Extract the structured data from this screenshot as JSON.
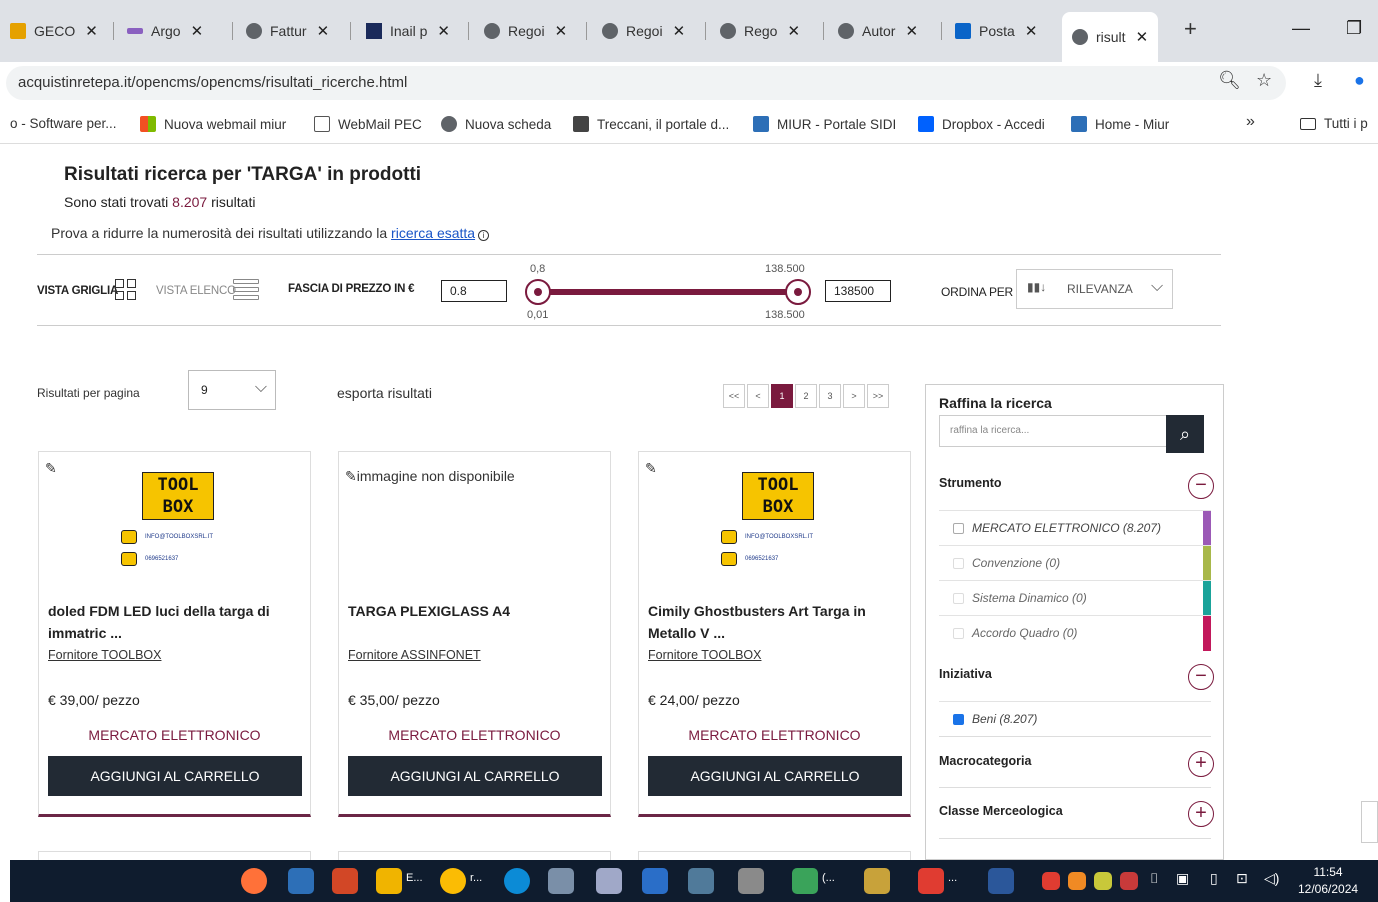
{
  "browser": {
    "tabs": [
      {
        "label": "GECO"
      },
      {
        "label": "Argo"
      },
      {
        "label": "Fattur"
      },
      {
        "label": "Inail p"
      },
      {
        "label": "Regoi"
      },
      {
        "label": "Regoi"
      },
      {
        "label": "Rego"
      },
      {
        "label": "Autor"
      },
      {
        "label": "Posta"
      },
      {
        "label": "risult"
      }
    ],
    "url": "acquistinretepa.it/opencms/opencms/risultati_ricerche.html",
    "bookmarks": [
      "o - Software per...",
      "Nuova webmail miur",
      "WebMail PEC",
      "Nuova scheda",
      "Treccani, il portale d...",
      "MIUR - Portale SIDI",
      "Dropbox - Accedi",
      "Home - Miur"
    ],
    "all_bookmarks": "Tutti i p"
  },
  "results": {
    "title": "Risultati ricerca per 'TARGA' in prodotti",
    "found_prefix": "Sono stati trovati ",
    "found_count": "8.207",
    "found_suffix": " risultati",
    "hint_prefix": "Prova a ridurre la numerosità dei risultati utilizzando la ",
    "hint_link": "ricerca esatta"
  },
  "toolbar": {
    "grid_view": "VISTA GRIGLIA",
    "list_view": "VISTA ELENCO",
    "price_label": "FASCIA DI PREZZO IN €",
    "price_min": "0.8",
    "price_max": "138500",
    "slider_top_min": "0,8",
    "slider_top_max": "138.500",
    "slider_bottom_min": "0,01",
    "slider_bottom_max": "138.500",
    "sort_label": "ORDINA PER",
    "sort_value": "RILEVANZA"
  },
  "listing": {
    "per_page_label": "Risultati per pagina",
    "per_page_value": "9",
    "export": "esporta risultati",
    "pages": [
      "<<",
      "<",
      "1",
      "2",
      "3",
      ">",
      ">>"
    ]
  },
  "products": [
    {
      "title": "doled FDM LED luci della targa di immatric ...",
      "supplier": "Fornitore TOOLBOX",
      "price": "€ 39,00/ pezzo",
      "market": "MERCATO ELETTRONICO",
      "button": "AGGIUNGI AL CARRELLO",
      "logo_top": "TOOL",
      "logo_bottom": "BOX",
      "logo_email": "INFO@TOOLBOXSRL.IT",
      "logo_phone": "0696521637"
    },
    {
      "title": "TARGA PLEXIGLASS A4",
      "supplier": "Fornitore ASSINFONET",
      "price": "€ 35,00/ pezzo",
      "market": "MERCATO ELETTRONICO",
      "button": "AGGIUNGI AL CARRELLO",
      "no_image": "immagine non disponibile"
    },
    {
      "title": "Cimily Ghostbusters Art Targa in Metallo V ...",
      "supplier": "Fornitore TOOLBOX",
      "price": "€ 24,00/ pezzo",
      "market": "MERCATO ELETTRONICO",
      "button": "AGGIUNGI AL CARRELLO",
      "logo_top": "TOOL",
      "logo_bottom": "BOX",
      "logo_email": "INFO@TOOLBOXSRL.IT",
      "logo_phone": "0696521637"
    }
  ],
  "refine": {
    "title": "Raffina la ricerca",
    "placeholder": "raffina la ricerca...",
    "strumento": "Strumento",
    "strumento_options": [
      {
        "label": "MERCATO ELETTRONICO",
        "count": "(8.207)",
        "color": "#9b59b6"
      },
      {
        "label": "Convenzione",
        "count": "(0)",
        "color": "#a8b84a"
      },
      {
        "label": "Sistema Dinamico",
        "count": "(0)",
        "color": "#1aa39a"
      },
      {
        "label": "Accordo Quadro",
        "count": "(0)",
        "color": "#c2185b"
      }
    ],
    "iniziativa": "Iniziativa",
    "iniziativa_options": [
      {
        "label": "Beni",
        "count": "(8.207)"
      }
    ],
    "macrocategoria": "Macrocategoria",
    "classe": "Classe Merceologica"
  },
  "taskbar": {
    "time": "11:54",
    "date": "12/06/2024"
  }
}
